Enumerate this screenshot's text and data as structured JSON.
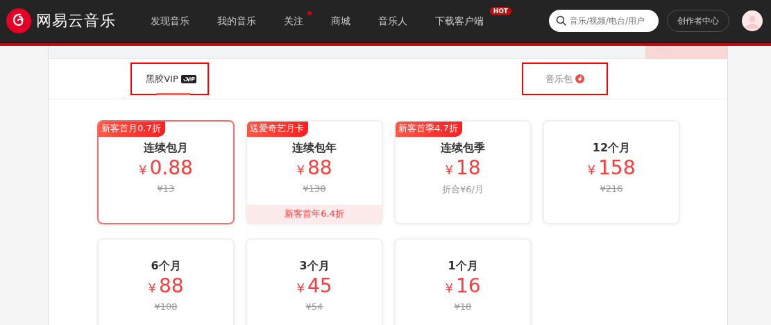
{
  "topbar": {
    "brand": "网易云音乐",
    "nav": [
      {
        "label": "发现音乐",
        "dot": false
      },
      {
        "label": "我的音乐",
        "dot": false
      },
      {
        "label": "关注",
        "dot": true
      },
      {
        "label": "商城",
        "dot": false
      },
      {
        "label": "音乐人",
        "dot": false
      },
      {
        "label": "下载客户端",
        "dot": false,
        "badge": "HOT"
      }
    ],
    "search": {
      "placeholder": "音乐/视频/电台/用户"
    },
    "creator_button": "创作者中心"
  },
  "tabs": [
    {
      "label": "黑胶VIP",
      "selected": true,
      "kind": "vip"
    },
    {
      "label": "音乐包",
      "selected": false,
      "kind": "pack"
    }
  ],
  "plans": [
    {
      "tag": "新客首月0.7折",
      "title": "连续包月",
      "currency": "¥",
      "price": "0.88",
      "note": "¥13",
      "struck": true,
      "selected": true
    },
    {
      "tag": "送爱奇艺月卡",
      "title": "连续包年",
      "currency": "¥",
      "price": "88",
      "note": "¥138",
      "struck": true,
      "footer": "新客首年6.4折",
      "selected": false
    },
    {
      "tag": "新客首季4.7折",
      "title": "连续包季",
      "currency": "¥",
      "price": "18",
      "note": "折合¥6/月",
      "struck": false,
      "selected": false
    },
    {
      "title": "12个月",
      "currency": "¥",
      "price": "158",
      "note": "¥216",
      "struck": true,
      "selected": false
    },
    {
      "title": "6个月",
      "currency": "¥",
      "price": "88",
      "note": "¥108",
      "struck": true,
      "selected": false
    },
    {
      "title": "3个月",
      "currency": "¥",
      "price": "45",
      "note": "¥54",
      "struck": true,
      "selected": false
    },
    {
      "title": "1个月",
      "currency": "¥",
      "price": "16",
      "note": "¥18",
      "struck": true,
      "selected": false
    }
  ]
}
